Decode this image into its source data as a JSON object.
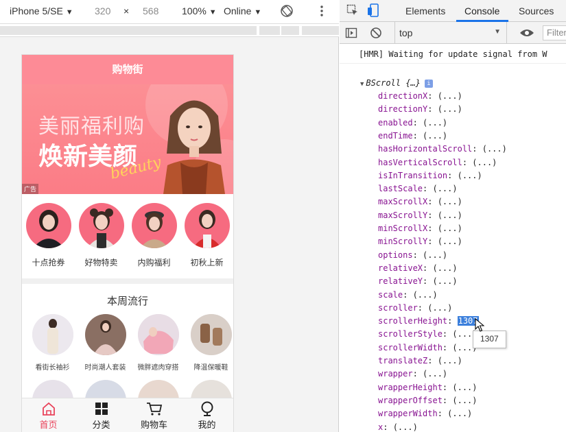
{
  "device_toolbar": {
    "device": "iPhone 5/SE",
    "width": "320",
    "times": "×",
    "height": "568",
    "zoom": "100%",
    "network": "Online"
  },
  "app": {
    "header_title": "购物街",
    "banner": {
      "line1": "美丽福利购",
      "line2": "焕新美颜",
      "script": "beauty",
      "ad_tag": "广告"
    },
    "recommends": [
      {
        "label": "十点抢券"
      },
      {
        "label": "好物特卖"
      },
      {
        "label": "内购福利"
      },
      {
        "label": "初秋上新"
      }
    ],
    "feature_title": "本周流行",
    "popular": [
      {
        "label": "看街长袖衫"
      },
      {
        "label": "时尚潮人套装"
      },
      {
        "label": "微胖遮肉穿搭"
      },
      {
        "label": "降温保暖鞋"
      }
    ],
    "tabbar": [
      {
        "label": "首页",
        "icon": "home-icon",
        "active": true
      },
      {
        "label": "分类",
        "icon": "category-grid-icon",
        "active": false
      },
      {
        "label": "购物车",
        "icon": "cart-icon",
        "active": false
      },
      {
        "label": "我的",
        "icon": "profile-icon",
        "active": false
      }
    ],
    "colors": {
      "header": "#fd8b96",
      "active_tab": "#e9425a"
    }
  },
  "devtools": {
    "tabs": [
      "Elements",
      "Console",
      "Sources"
    ],
    "active_tab": "Console",
    "context": "top",
    "filter_placeholder": "Filter",
    "hmr_message": "[HMR] Waiting for update signal from W",
    "object_name": "BScroll {…}",
    "properties": [
      {
        "key": "directionX",
        "value": "(...)"
      },
      {
        "key": "directionY",
        "value": "(...)"
      },
      {
        "key": "enabled",
        "value": "(...)"
      },
      {
        "key": "endTime",
        "value": "(...)"
      },
      {
        "key": "hasHorizontalScroll",
        "value": "(...)"
      },
      {
        "key": "hasVerticalScroll",
        "value": "(...)"
      },
      {
        "key": "isInTransition",
        "value": "(...)"
      },
      {
        "key": "lastScale",
        "value": "(...)"
      },
      {
        "key": "maxScrollX",
        "value": "(...)"
      },
      {
        "key": "maxScrollY",
        "value": "(...)"
      },
      {
        "key": "minScrollX",
        "value": "(...)"
      },
      {
        "key": "minScrollY",
        "value": "(...)"
      },
      {
        "key": "options",
        "value": "(...)"
      },
      {
        "key": "relativeX",
        "value": "(...)"
      },
      {
        "key": "relativeY",
        "value": "(...)"
      },
      {
        "key": "scale",
        "value": "(...)"
      },
      {
        "key": "scroller",
        "value": "(...)"
      },
      {
        "key": "scrollerHeight",
        "value": "1307"
      },
      {
        "key": "scrollerStyle",
        "value": "(...)"
      },
      {
        "key": "scrollerWidth",
        "value": "(...)"
      },
      {
        "key": "translateZ",
        "value": "(...)"
      },
      {
        "key": "wrapper",
        "value": "(...)"
      },
      {
        "key": "wrapperHeight",
        "value": "(...)"
      },
      {
        "key": "wrapperOffset",
        "value": "(...)"
      },
      {
        "key": "wrapperWidth",
        "value": "(...)"
      },
      {
        "key": "x",
        "value": "(...)"
      }
    ],
    "tooltip": "1307"
  }
}
